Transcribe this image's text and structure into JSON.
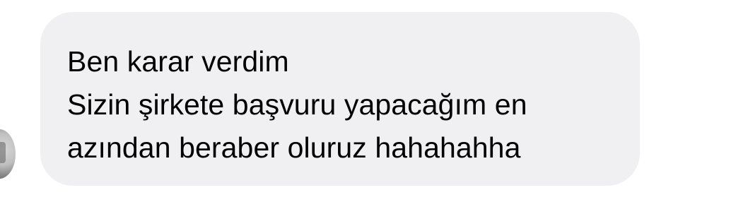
{
  "conversation": {
    "avatar_icon": "user-avatar-icon",
    "message": {
      "bubble_color": "#f0f0f2",
      "text_color": "#000000",
      "lines": [
        "Ben karar verdim",
        "Sizin şirkete başvuru yapacağım en",
        "azından beraber oluruz hahahahha"
      ]
    }
  }
}
